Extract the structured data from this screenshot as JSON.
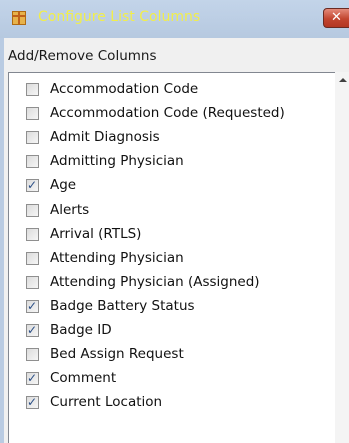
{
  "window": {
    "title": "Configure List Columns",
    "close_glyph": "✕"
  },
  "group": {
    "label": "Add/Remove Columns"
  },
  "items": [
    {
      "label": "Accommodation Code",
      "checked": false
    },
    {
      "label": "Accommodation Code (Requested)",
      "checked": false
    },
    {
      "label": "Admit Diagnosis",
      "checked": false
    },
    {
      "label": "Admitting Physician",
      "checked": false
    },
    {
      "label": "Age",
      "checked": true
    },
    {
      "label": "Alerts",
      "checked": false
    },
    {
      "label": "Arrival (RTLS)",
      "checked": false
    },
    {
      "label": "Attending Physician",
      "checked": false
    },
    {
      "label": "Attending Physician (Assigned)",
      "checked": false
    },
    {
      "label": "Badge Battery Status",
      "checked": true
    },
    {
      "label": "Badge ID",
      "checked": true
    },
    {
      "label": "Bed Assign Request",
      "checked": false
    },
    {
      "label": "Comment",
      "checked": true
    },
    {
      "label": "Current Location",
      "checked": true
    }
  ],
  "check_glyph": "✓",
  "colors": {
    "title_text": "#f2ee4a",
    "check_mark": "#2b4f86",
    "close_button": "#c2452f"
  }
}
